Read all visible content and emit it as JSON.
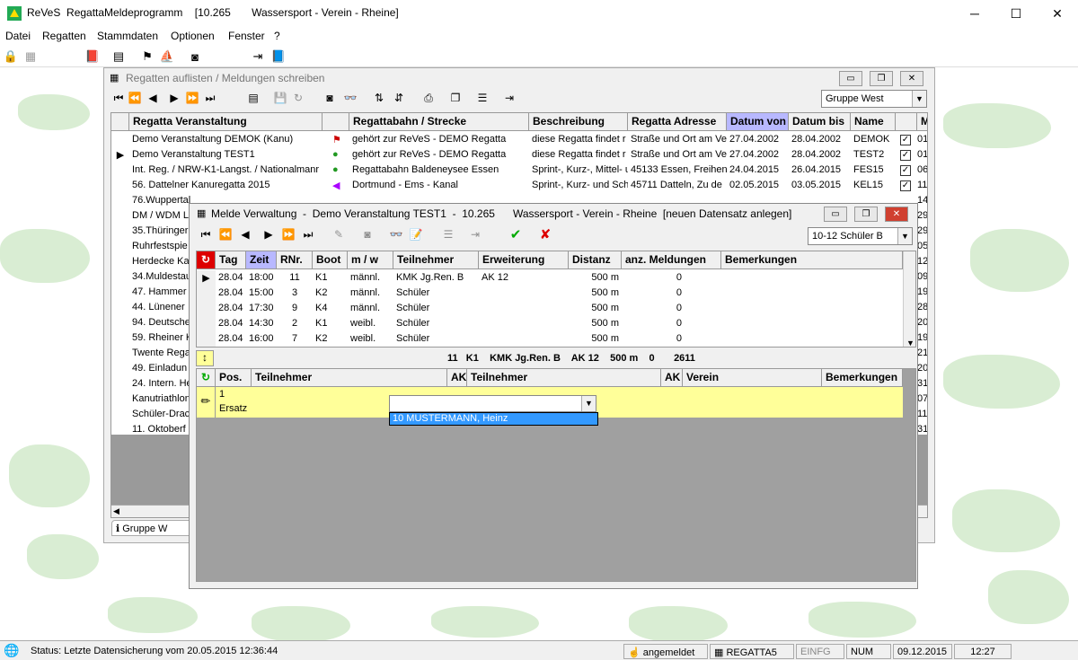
{
  "app": {
    "title": "ReVeS  RegattaMeldeprogramm    [10.265       Wassersport - Verein - Rheine]",
    "min": "─",
    "max": "☐",
    "close": "✕"
  },
  "menu": [
    "Datei",
    "Regatten",
    "Stammdaten",
    "Optionen",
    "Fenster",
    "?"
  ],
  "regatten_window": {
    "title": "Regatten auflisten / Meldungen schreiben",
    "group_combo": "Gruppe West",
    "columns": [
      "Regatta Veranstaltung",
      "Regattabahn / Strecke",
      "Beschreibung",
      "Regatta Adresse",
      "Datum von",
      "Datum bis",
      "Name",
      "M"
    ],
    "rows": [
      {
        "name": "Demo Veranstaltung DEMOK (Kanu)",
        "bahn": "gehört zur ReVeS - DEMO Regatta",
        "beschr": "diese Regatta findet r",
        "adr": "Straße und Ort am Ve",
        "von": "27.04.2002",
        "bis": "28.04.2002",
        "kurz": "DEMOK",
        "m": "01"
      },
      {
        "name": "Demo Veranstaltung TEST1",
        "bahn": "gehört zur ReVeS - DEMO Regatta",
        "beschr": "diese Regatta findet r",
        "adr": "Straße und Ort am Ve",
        "von": "27.04.2002",
        "bis": "28.04.2002",
        "kurz": "TEST2",
        "m": "01"
      },
      {
        "name": "Int. Reg. / NRW-K1-Langst. / Nationalmanr",
        "bahn": "Regattabahn Baldeneysee Essen",
        "beschr": "Sprint-, Kurz-, Mittel- u",
        "adr": "45133 Essen, Freihen",
        "von": "24.04.2015",
        "bis": "26.04.2015",
        "kurz": "FES15",
        "m": "06"
      },
      {
        "name": "56. Dattelner Kanuregatta 2015",
        "bahn": "Dortmund - Ems - Kanal",
        "beschr": "Sprint-, Kurz- und Sch",
        "adr": "45711 Datteln, Zu de",
        "von": "02.05.2015",
        "bis": "03.05.2015",
        "kurz": "KEL15",
        "m": "11"
      },
      {
        "name": "76.Wuppertal",
        "m": "14"
      },
      {
        "name": "DM / WDM L",
        "m": "29"
      },
      {
        "name": "35.Thüringer",
        "m": "29"
      },
      {
        "name": "Ruhrfestspie",
        "m": "05"
      },
      {
        "name": "Herdecke Ka",
        "m": "12"
      },
      {
        "name": "34.Muldestau",
        "m": "09"
      },
      {
        "name": "47. Hammer",
        "m": "19"
      },
      {
        "name": "44. Lünener",
        "m": "28"
      },
      {
        "name": "94. Deutsche",
        "m": "20"
      },
      {
        "name": "59. Rheiner K",
        "m": "19"
      },
      {
        "name": "Twente Rega",
        "m": "21"
      },
      {
        "name": "49. Einladun",
        "m": "20"
      },
      {
        "name": "24. Intern. He",
        "m": "31"
      },
      {
        "name": "Kanutriathlon",
        "m": "07"
      },
      {
        "name": "Schüler-Drac",
        "m": "11"
      },
      {
        "name": "11. Oktoberf",
        "m": "31"
      }
    ],
    "footer_tab": "Gruppe W"
  },
  "melde_window": {
    "title": "Melde Verwaltung  -  Demo Veranstaltung TEST1  -  10.265      Wassersport - Verein - Rheine  [neuen Datensatz anlegen]",
    "class_combo": "10-12 Schüler B",
    "columns": [
      "Tag",
      "Zeit",
      "RNr.",
      "Boot",
      "m / w",
      "Teilnehmer",
      "Erweiterung",
      "Distanz",
      "anz. Meldungen",
      "Bemerkungen"
    ],
    "rows": [
      {
        "tag": "28.04",
        "zeit": "18:00",
        "rnr": "11",
        "boot": "K1",
        "mw": "männl.",
        "tn": "KMK Jg.Ren. B",
        "erw": "AK 12",
        "dist": "500 m",
        "anz": "0"
      },
      {
        "tag": "28.04",
        "zeit": "15:00",
        "rnr": "3",
        "boot": "K2",
        "mw": "männl.",
        "tn": "Schüler",
        "erw": "",
        "dist": "500 m",
        "anz": "0"
      },
      {
        "tag": "28.04",
        "zeit": "17:30",
        "rnr": "9",
        "boot": "K4",
        "mw": "männl.",
        "tn": "Schüler",
        "erw": "",
        "dist": "500 m",
        "anz": "0"
      },
      {
        "tag": "28.04",
        "zeit": "14:30",
        "rnr": "2",
        "boot": "K1",
        "mw": "weibl.",
        "tn": "Schüler",
        "erw": "",
        "dist": "500 m",
        "anz": "0"
      },
      {
        "tag": "28.04",
        "zeit": "16:00",
        "rnr": "7",
        "boot": "K2",
        "mw": "weibl.",
        "tn": "Schüler",
        "erw": "",
        "dist": "500 m",
        "anz": "0"
      }
    ],
    "summary": "11   K1    KMK Jg.Ren. B    AK 12    500 m    0       2611",
    "entry_columns": [
      "Pos.",
      "Teilnehmer",
      "AK",
      "Teilnehmer",
      "AK",
      "Verein",
      "Bemerkungen"
    ],
    "entry_pos": "1",
    "entry_ersatz": "Ersatz",
    "dropdown_option": "10  MUSTERMANN, Heinz"
  },
  "status": {
    "text": "Status:  Letzte Datensicherung vom  20.05.2015  12:36:44",
    "user": "angemeldet",
    "db": "REGATTA5",
    "einfg": "EINFG",
    "num": "NUM",
    "date": "09.12.2015",
    "time": "12:27"
  },
  "colors": {
    "highlight": "#b8b8ff",
    "entry_yellow": "#ffff99",
    "dropdown_sel": "#3399ff"
  }
}
